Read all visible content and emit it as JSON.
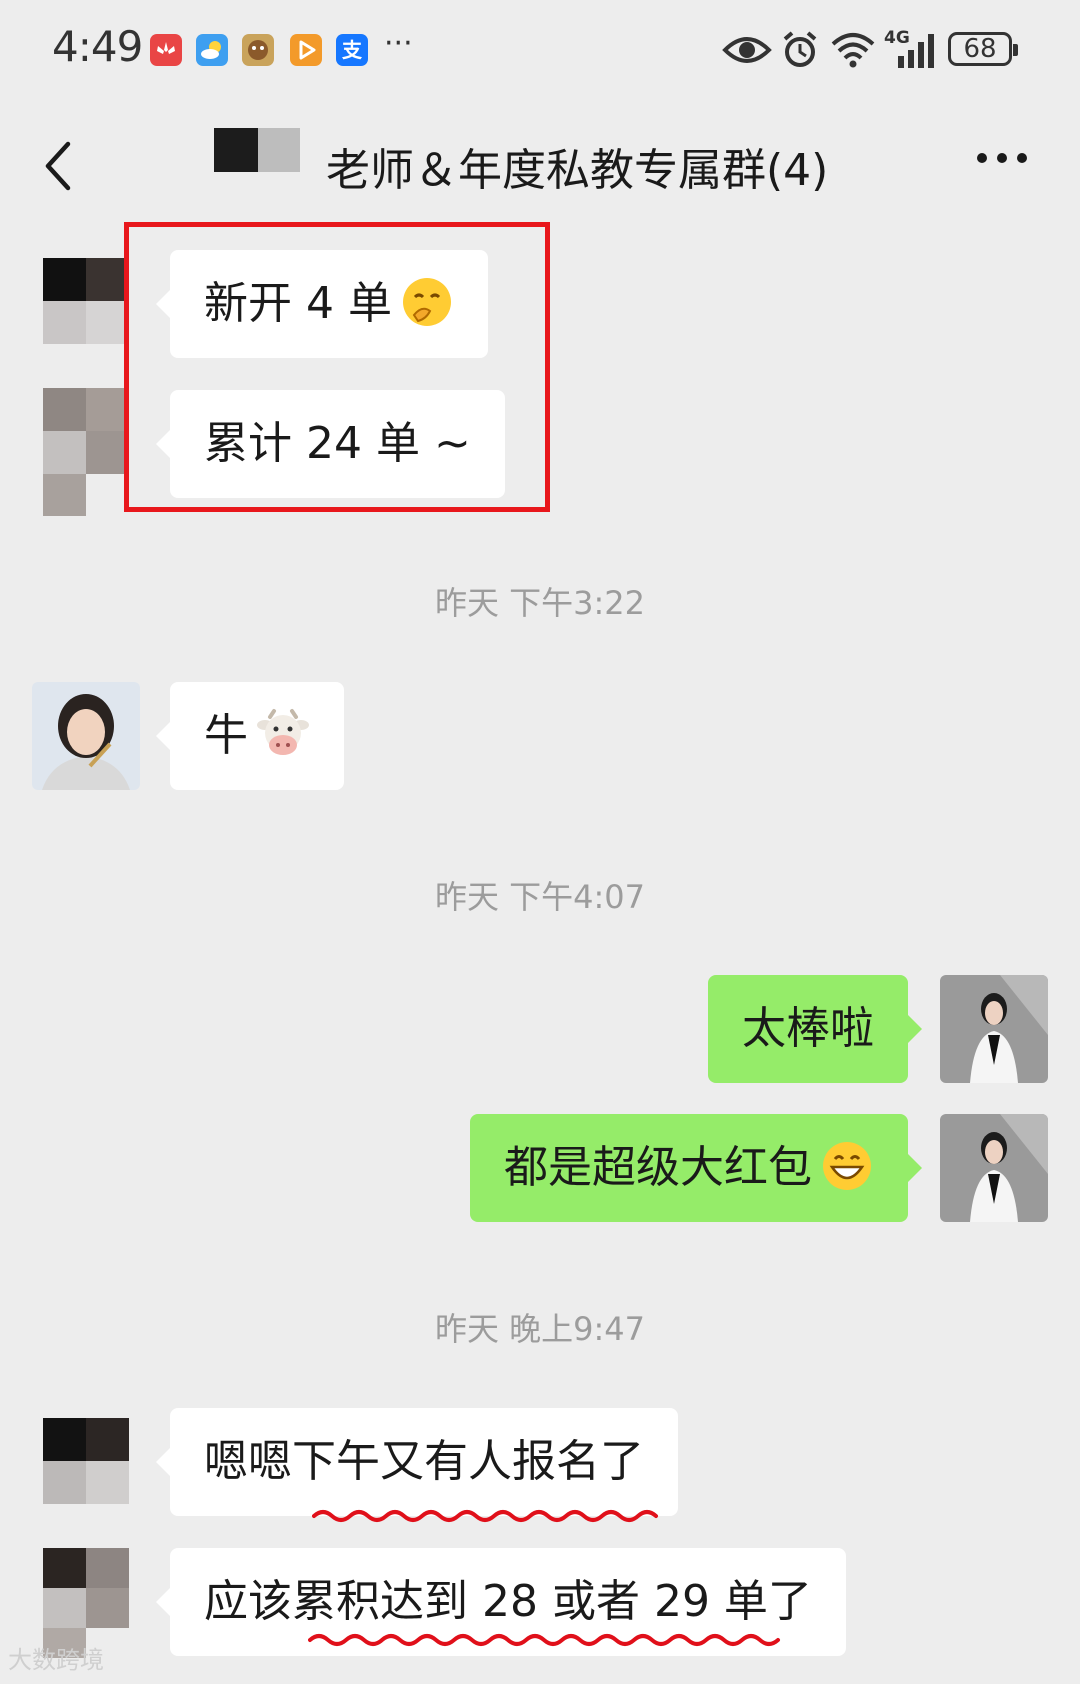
{
  "status_bar": {
    "time": "4:49",
    "dots": "···",
    "network": "4G",
    "battery": "68",
    "app_icons": [
      "huawei-icon",
      "weather-icon",
      "game-icon",
      "video-icon",
      "alipay-icon"
    ],
    "alipay_glyph": "支"
  },
  "nav": {
    "title": "老师＆年度私教专属群(4)"
  },
  "messages": [
    {
      "side": "left",
      "text": "新开 4 单",
      "emoji": "shy-face-emoji"
    },
    {
      "side": "left",
      "text": "累计 24 单 ~"
    },
    {
      "timestamp": "昨天 下午3:22"
    },
    {
      "side": "left",
      "text": "牛",
      "emoji": "cow-face-emoji"
    },
    {
      "timestamp": "昨天 下午4:07"
    },
    {
      "side": "right",
      "text": "太棒啦"
    },
    {
      "side": "right",
      "text": "都是超级大红包",
      "emoji": "grinning-face-emoji"
    },
    {
      "timestamp": "昨天 晚上9:47"
    },
    {
      "side": "left",
      "text": "嗯嗯下午又有人报名了"
    },
    {
      "side": "left",
      "text": "应该累积达到 28 或者 29 单了"
    }
  ],
  "watermark": "大数跨境",
  "colors": {
    "background": "#ededed",
    "bubble_left": "#ffffff",
    "bubble_right": "#95ec69",
    "highlight_red": "#e8171c",
    "timestamp_gray": "#9c9c9c"
  }
}
